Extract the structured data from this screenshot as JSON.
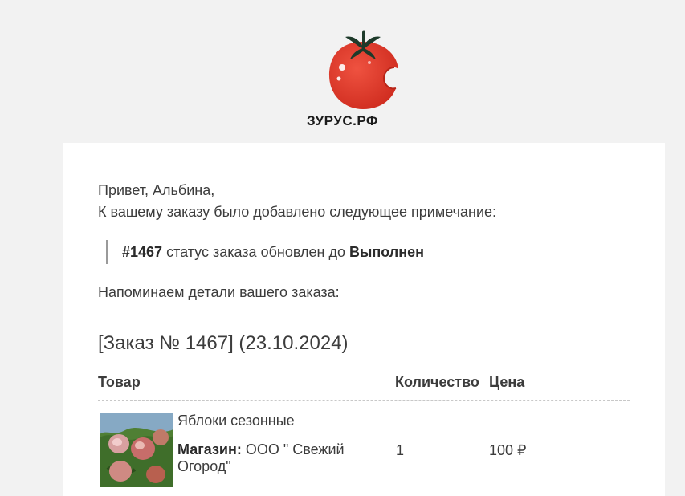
{
  "brand": {
    "name": "ЗУРУС.РФ",
    "tomato_color": "#e23a2b",
    "leaf_color": "#1d3a2a"
  },
  "email": {
    "greeting": "Привет, Альбина,",
    "intro": "К вашему заказу было добавлено следующее примечание:",
    "note": {
      "order_ref": "#1467",
      "text": " статус заказа обновлен до ",
      "status": "Выполнен"
    },
    "reminder": "Напоминаем детали вашего заказа:",
    "order_title": "[Заказ № 1467] (23.10.2024)"
  },
  "table": {
    "headers": {
      "product": "Товар",
      "quantity": "Количество",
      "price": "Цена"
    },
    "rows": [
      {
        "image": "apples-image",
        "name": "Яблоки сезонные",
        "shop_label": "Магазин:",
        "shop_value": " ООО \" Свежий Огород\"",
        "quantity": "1",
        "price": "100 ₽"
      }
    ]
  }
}
